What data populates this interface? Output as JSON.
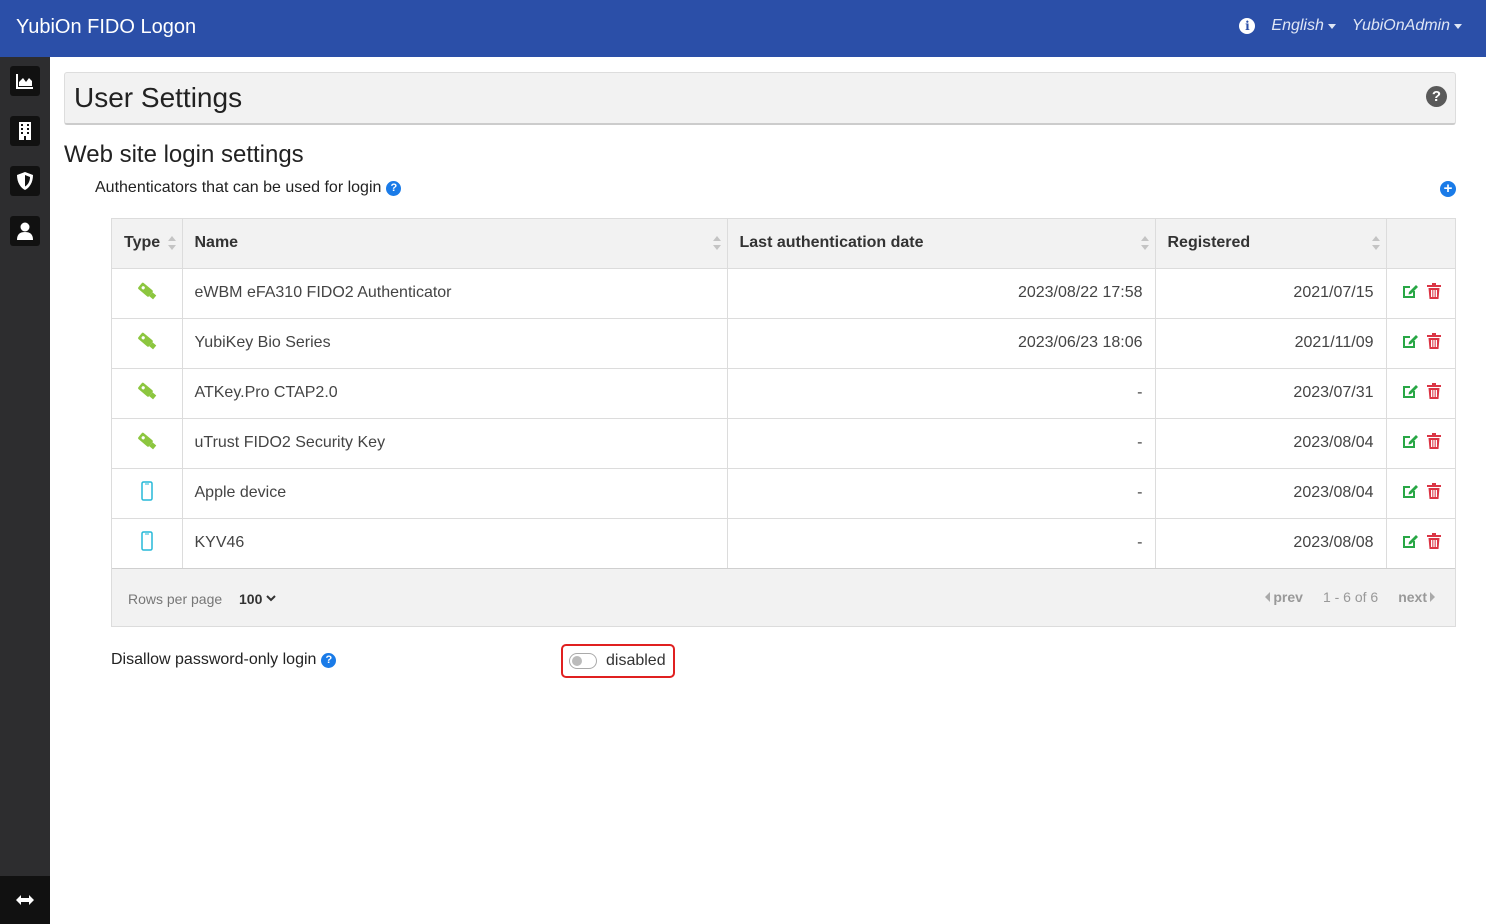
{
  "app": {
    "title": "YubiOn FIDO Logon",
    "language": "English",
    "user": "YubiOnAdmin"
  },
  "page": {
    "title": "User Settings"
  },
  "section": {
    "title": "Web site login settings",
    "authenticators_label": "Authenticators that can be used for login"
  },
  "table": {
    "columns": [
      "Type",
      "Name",
      "Last authentication date",
      "Registered"
    ],
    "rows": [
      {
        "type": "security-key",
        "name": "eWBM eFA310 FIDO2 Authenticator",
        "last_auth": "2023/08/22 17:58",
        "registered": "2021/07/15"
      },
      {
        "type": "security-key",
        "name": "YubiKey Bio Series",
        "last_auth": "2023/06/23 18:06",
        "registered": "2021/11/09"
      },
      {
        "type": "security-key",
        "name": "ATKey.Pro CTAP2.0",
        "last_auth": "-",
        "registered": "2023/07/31"
      },
      {
        "type": "security-key",
        "name": "uTrust FIDO2 Security Key",
        "last_auth": "-",
        "registered": "2023/08/04"
      },
      {
        "type": "mobile-device",
        "name": "Apple device",
        "last_auth": "-",
        "registered": "2023/08/04"
      },
      {
        "type": "mobile-device",
        "name": "KYV46",
        "last_auth": "-",
        "registered": "2023/08/08"
      }
    ],
    "footer": {
      "rows_per_page_label": "Rows per page",
      "rows_per_page_value": "100",
      "prev": "prev",
      "range": "1 - 6 of 6",
      "next": "next"
    }
  },
  "disallow": {
    "label": "Disallow password-only login",
    "toggle_state": "disabled"
  },
  "colors": {
    "topbar": "#2b4fa8",
    "sidebar": "#2d2d2f",
    "key_icon": "#8cc63f",
    "device_icon": "#27b9d8",
    "edit_icon": "#28a745",
    "delete_icon": "#dc3545",
    "help_icon": "#1a7be8",
    "highlight_border": "#e02020"
  }
}
